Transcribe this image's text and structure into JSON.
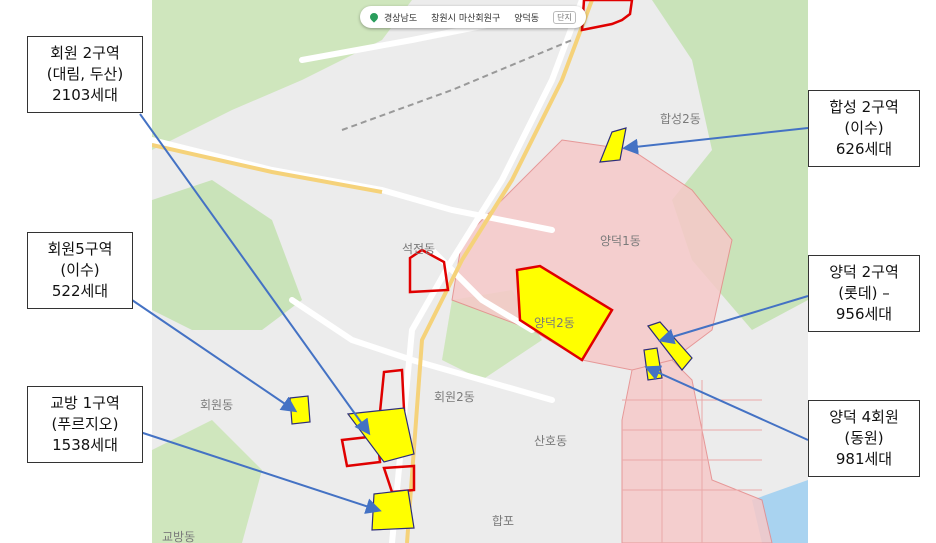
{
  "breadcrumb": {
    "items": [
      "경상남도",
      "창원시 마산회원구",
      "양덕동"
    ],
    "unit_label": "단지"
  },
  "dong_labels": {
    "hapseong2": "합성2동",
    "yangdeok1": "양덕1동",
    "yangdeok2": "양덕2동",
    "seokjeon": "석전동",
    "hoewon2": "회원2동",
    "sanho": "산호동",
    "hoewon": "회원동",
    "gyobang": "교방동",
    "happo": "합포"
  },
  "labels": [
    {
      "id": "hoewon2",
      "lines": [
        "회원 2구역",
        "(대림, 두산)",
        "2103세대"
      ]
    },
    {
      "id": "hoewon5",
      "lines": [
        "회원5구역",
        "(이수)",
        "522세대"
      ]
    },
    {
      "id": "gyobang1",
      "lines": [
        "교방 1구역",
        "(푸르지오)",
        "1538세대"
      ]
    },
    {
      "id": "hapseong2",
      "lines": [
        "합성 2구역",
        "(이수)",
        "626세대"
      ]
    },
    {
      "id": "yangdeok2",
      "lines": [
        "양덕 2구역",
        "(롯데) –",
        "956세대"
      ]
    },
    {
      "id": "yangdeok4",
      "lines": [
        "양덕 4회원",
        "(동원)",
        "981세대"
      ]
    }
  ],
  "colors": {
    "zone_fill": "#ffff00",
    "zone_stroke": "#e00000",
    "arrow": "#4472c4",
    "district_fill": "#f6c9c9",
    "park": "#c9e3b9",
    "map_bg": "#ececec"
  }
}
